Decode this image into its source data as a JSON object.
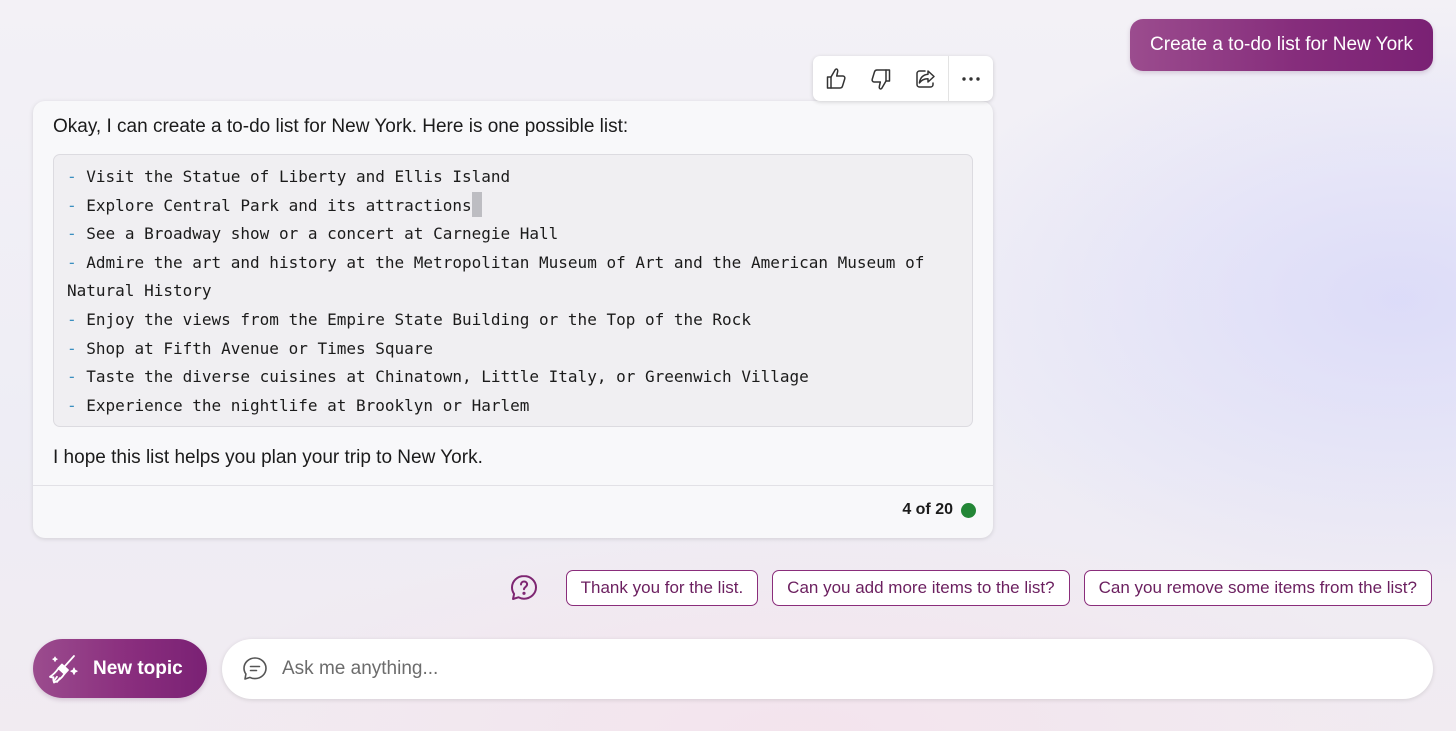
{
  "user_message": {
    "text": "Create a to-do list for New York"
  },
  "reactions": [
    {
      "name": "thumbs-up-icon",
      "label": "Like"
    },
    {
      "name": "thumbs-down-icon",
      "label": "Dislike"
    },
    {
      "name": "share-icon",
      "label": "Share"
    },
    {
      "name": "more-options-icon",
      "label": "More"
    }
  ],
  "response": {
    "intro": "Okay, I can create a to-do list for New York. Here is one possible list:",
    "list_items": [
      "Visit the Statue of Liberty and Ellis Island",
      "Explore Central Park and its attractions",
      "See a Broadway show or a concert at Carnegie Hall",
      "Admire the art and history at the Metropolitan Museum of Art and the American Museum of",
      "Natural History",
      "Enjoy the views from the Empire State Building or the Top of the Rock",
      "Shop at Fifth Avenue or Times Square",
      "Taste the diverse cuisines at Chinatown, Little Italy, or Greenwich Village",
      "Experience the nightlife at Brooklyn or Harlem"
    ],
    "list_dash": "-",
    "outro": "I hope this list helps you plan your trip to New York.",
    "turn_counter": "4 of 20",
    "status_color": "#238636"
  },
  "suggestions": {
    "icon": "question-bubble-icon",
    "chips": [
      "Thank you for the list.",
      "Can you add more items to the list?",
      "Can you remove some items from the list?"
    ]
  },
  "composer": {
    "new_topic_label": "New topic",
    "new_topic_icon": "broom-icon",
    "input_icon": "chat-bubble-icon",
    "placeholder": "Ask me anything..."
  },
  "colors": {
    "accent": "#862d7c",
    "chip_text": "#6b1f5f",
    "list_dash": "#3a8fc0"
  }
}
